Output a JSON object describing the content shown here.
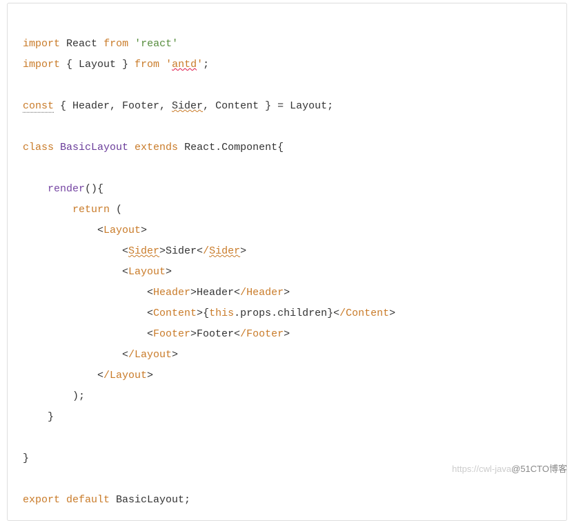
{
  "code": {
    "l1_kw1": "import",
    "l1_id": "React",
    "l1_kw2": "from",
    "l1_str": "'react'",
    "l2_kw1": "import",
    "l2_id1": " { Layout } ",
    "l2_kw2": "from",
    "l2_sp": " ",
    "l2_q1": "'",
    "l2_str": "antd",
    "l2_q2": "'",
    "l2_end": ";",
    "l4_kw": "const",
    "l4_mid1": " { Header, Footer, ",
    "l4_sider": "Sider",
    "l4_mid2": ", Content } = Layout;",
    "l6_kw1": "class",
    "l6_id1": " BasicLayout ",
    "l6_kw2": "extends",
    "l6_id2": " React.Component{",
    "l8_fn": "render",
    "l8_rest": "(){",
    "l9_kw": "return",
    "l9_rest": " (",
    "l10_lt": "            <",
    "l10_tag": "Layout",
    "l10_gt": ">",
    "l11_pre": "                <",
    "l11_tag": "Sider",
    "l11_mid": ">Sider<",
    "l11_ct": "/",
    "l11_ctn": "Sider",
    "l11_end": ">",
    "l12_pre": "                <",
    "l12_tag": "Layout",
    "l12_gt": ">",
    "l13_pre": "                    <",
    "l13_tag": "Header",
    "l13_mid": ">Header<",
    "l13_ct": "/Header",
    "l13_end": ">",
    "l14_pre": "                    <",
    "l14_tag": "Content",
    "l14_gt": ">",
    "l14_expr1": "{",
    "l14_this": "this",
    "l14_expr2": ".props.children}",
    "l14_lt2": "<",
    "l14_ct": "/Content",
    "l14_end": ">",
    "l15_pre": "                    <",
    "l15_tag": "Footer",
    "l15_mid": ">Footer<",
    "l15_ct": "/Footer",
    "l15_end": ">",
    "l16_pre": "                <",
    "l16_ct": "/Layout",
    "l16_end": ">",
    "l17_pre": "            <",
    "l17_ct": "/Layout",
    "l17_end": ">",
    "l18": "        );",
    "l19": "    }",
    "l21": "}",
    "l23_kw1": "export",
    "l23_kw2": " default",
    "l23_rest": " BasicLayout;"
  },
  "watermark": {
    "light": "https://cwl-java",
    "dark": "@51CTO博客"
  }
}
